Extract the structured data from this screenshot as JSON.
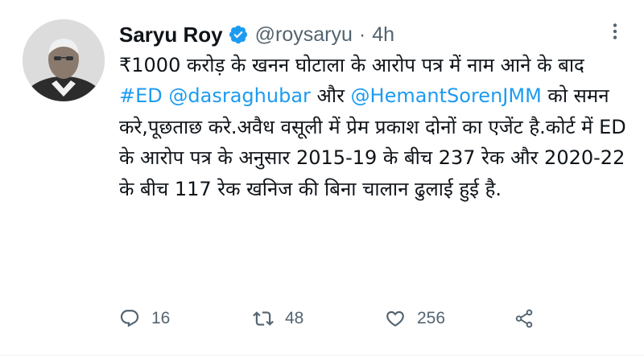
{
  "author": {
    "name": "Saryu Roy",
    "handle": "@roysaryu",
    "separator": "·",
    "time": "4h",
    "verified": true,
    "verified_color": "#1d9bf0"
  },
  "tweet": {
    "parts": [
      "₹1000 करोड़ के खनन घोटाला के आरोप पत्र में नाम आने के बाद ",
      "#ED",
      " ",
      "@dasraghubar",
      " और ",
      "@HemantSorenJMM",
      " को समन करे,पूछताछ करे.अवैध वसूली में प्रेम प्रकाश दोनों का एजेंट है.कोर्ट में ED के आरोप पत्र के अनुसार 2015-19 के बीच 237 रेक और 2020-22 के बीच 117 रेक खनिज की बिना चालान ढुलाई हुई है."
    ],
    "link_color": "#1d9bf0"
  },
  "actions": {
    "replies": "16",
    "retweets": "48",
    "likes": "256"
  },
  "icons": {
    "more": "more-icon",
    "reply": "reply-icon",
    "retweet": "retweet-icon",
    "like": "heart-icon",
    "share": "share-icon"
  }
}
